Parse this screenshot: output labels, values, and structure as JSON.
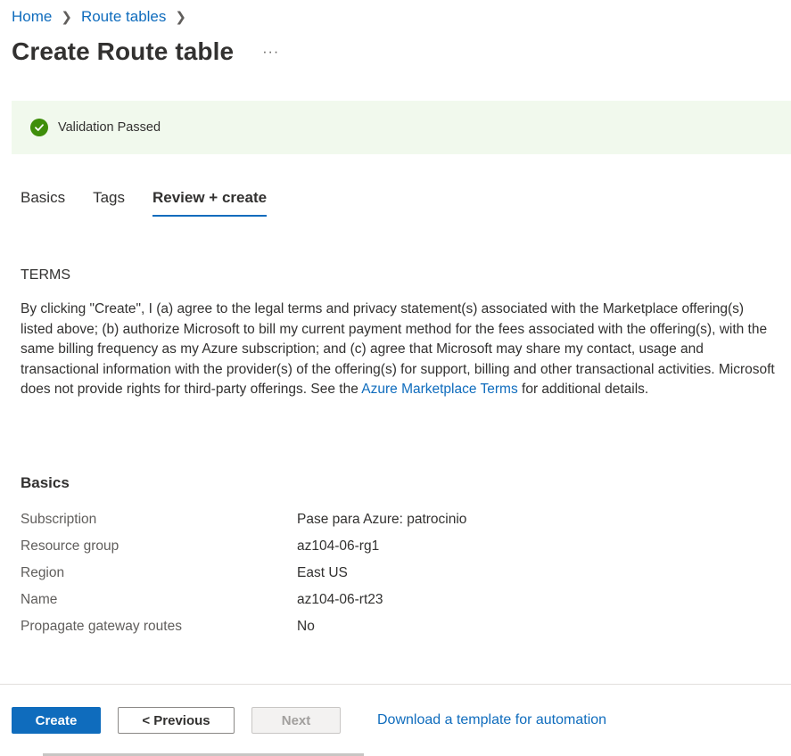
{
  "breadcrumb": {
    "items": [
      "Home",
      "Route tables"
    ]
  },
  "page": {
    "title": "Create Route table",
    "more_label": "···"
  },
  "validation": {
    "text": "Validation Passed",
    "color": "#3e8e0a"
  },
  "tabs": [
    {
      "label": "Basics",
      "active": false
    },
    {
      "label": "Tags",
      "active": false
    },
    {
      "label": "Review + create",
      "active": true
    }
  ],
  "terms": {
    "heading": "TERMS",
    "body_before": "By clicking \"Create\", I (a) agree to the legal terms and privacy statement(s) associated with the Marketplace offering(s) listed above; (b) authorize Microsoft to bill my current payment method for the fees associated with the offering(s), with the same billing frequency as my Azure subscription; and (c) agree that Microsoft may share my contact, usage and transactional information with the provider(s) of the offering(s) for support, billing and other transactional activities. Microsoft does not provide rights for third-party offerings. See the ",
    "link": "Azure Marketplace Terms",
    "body_after": " for additional details."
  },
  "basics": {
    "heading": "Basics",
    "rows": [
      {
        "label": "Subscription",
        "value": "Pase para Azure: patrocinio"
      },
      {
        "label": "Resource group",
        "value": "az104-06-rg1"
      },
      {
        "label": "Region",
        "value": "East US"
      },
      {
        "label": "Name",
        "value": "az104-06-rt23"
      },
      {
        "label": "Propagate gateway routes",
        "value": "No"
      }
    ]
  },
  "footer": {
    "create": "Create",
    "previous": "< Previous",
    "next": "Next",
    "download": "Download a template for automation"
  },
  "colors": {
    "accent": "#0f6cbd",
    "success_bg": "#f1f9ed"
  }
}
